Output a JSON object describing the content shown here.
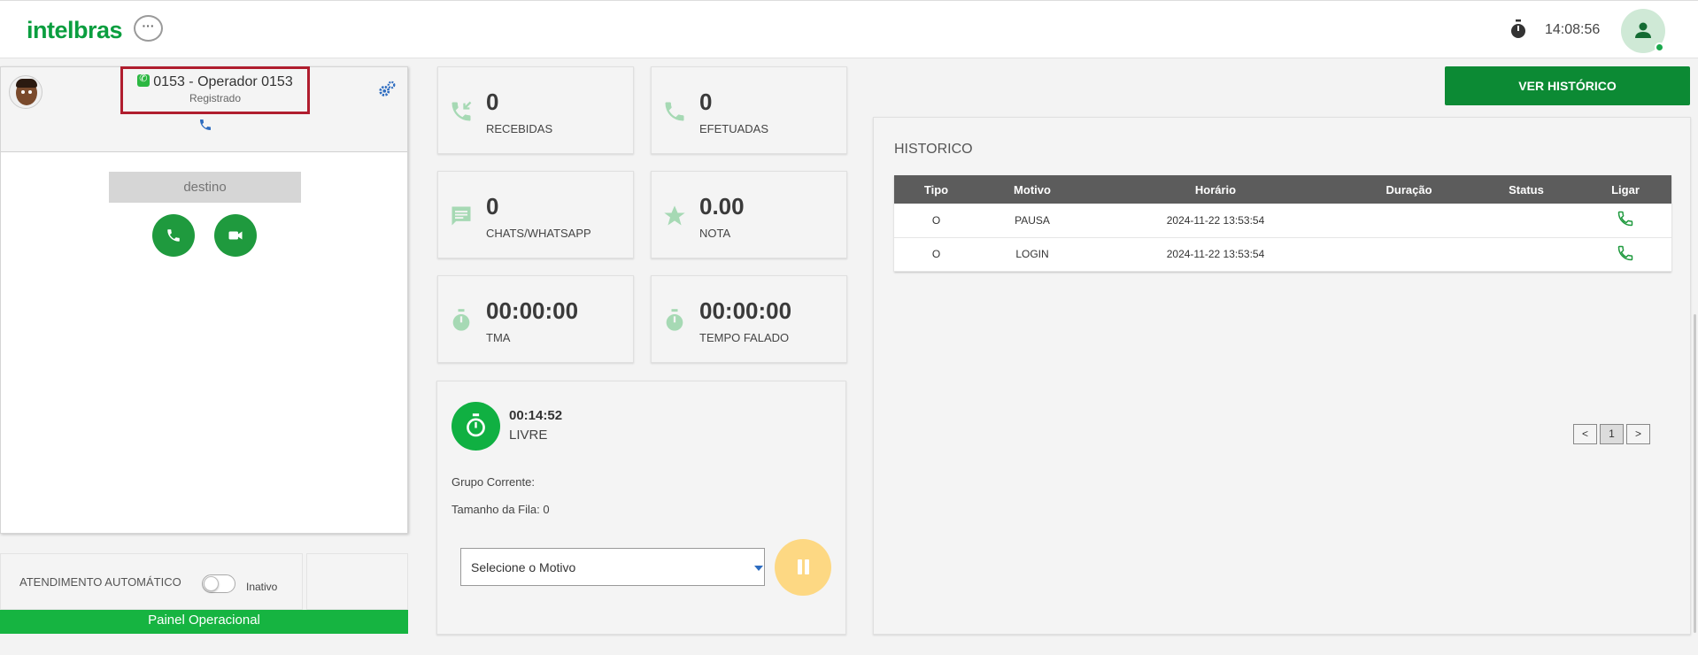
{
  "header": {
    "logo": "intelbras",
    "bubble": "···",
    "clock": "14:08:56"
  },
  "phone": {
    "operator": "0153 - Operador 0153",
    "status": "Registrado",
    "destino_placeholder": "destino"
  },
  "auto": {
    "label": "ATENDIMENTO AUTOMÁTICO",
    "toggle_state": "Inativo"
  },
  "painel_label": "Painel Operacional",
  "stats": {
    "recebidas": {
      "value": "0",
      "label": "RECEBIDAS"
    },
    "efetuadas": {
      "value": "0",
      "label": "EFETUADAS"
    },
    "chats": {
      "value": "0",
      "label": "CHATS/WHATSAPP"
    },
    "nota": {
      "value": "0.00",
      "label": "NOTA"
    },
    "tma": {
      "value": "00:00:00",
      "label": "TMA"
    },
    "tempo": {
      "value": "00:00:00",
      "label": "TEMPO FALADO"
    }
  },
  "status": {
    "time": "00:14:52",
    "state": "LIVRE",
    "grupo": "Grupo Corrente:",
    "fila": "Tamanho da Fila: 0",
    "motivo": "Selecione o Motivo"
  },
  "history": {
    "button": "VER HISTÓRICO",
    "title": "HISTORICO",
    "columns": [
      "Tipo",
      "Motivo",
      "Horário",
      "Duração",
      "Status",
      "Ligar"
    ],
    "rows": [
      {
        "tipo": "O",
        "motivo": "PAUSA",
        "horario": "2024-11-22 13:53:54",
        "duracao": "",
        "status": ""
      },
      {
        "tipo": "O",
        "motivo": "LOGIN",
        "horario": "2024-11-22 13:53:54",
        "duracao": "",
        "status": ""
      }
    ],
    "pager": {
      "prev": "<",
      "page": "1",
      "next": ">"
    }
  },
  "colors": {
    "brand_green": "#0a9e3f",
    "button_green": "#0c8a34",
    "highlight_red": "#b01d2e",
    "pause_yellow": "#fdd883"
  }
}
